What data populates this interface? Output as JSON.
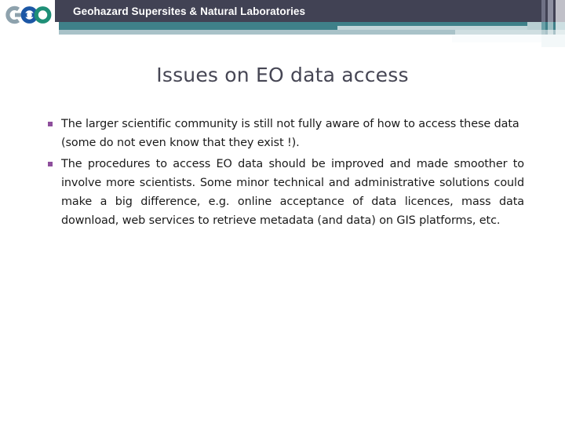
{
  "slide": {
    "header": {
      "banner_title": "Geohazard Supersites & Natural Laboratories",
      "logo_name": "geo-logo",
      "logo_text": "GEO",
      "colors": {
        "dark_bar": "#414254",
        "teal_band": "#3f8089",
        "light_band": "#a9c2c8",
        "banner_text": "#ffffff"
      }
    },
    "title": "Issues on EO data access",
    "title_color": "#464654",
    "bullets": [
      {
        "marker": "§",
        "text": "The larger scientific community is still not fully aware of how to access these data (some do not even know that they exist !).",
        "justified": false
      },
      {
        "marker": "§",
        "text": "The procedures to access EO data should be improved and made smoother to involve more scientists. Some minor technical and administrative solutions could make a big difference, e.g. online acceptance of data licences, mass data download, web services to retrieve metadata (and data) on GIS platforms, etc.",
        "justified": true
      }
    ],
    "bullet_color": "#8e4f9c",
    "body_text_color": "#1a1a1a"
  }
}
